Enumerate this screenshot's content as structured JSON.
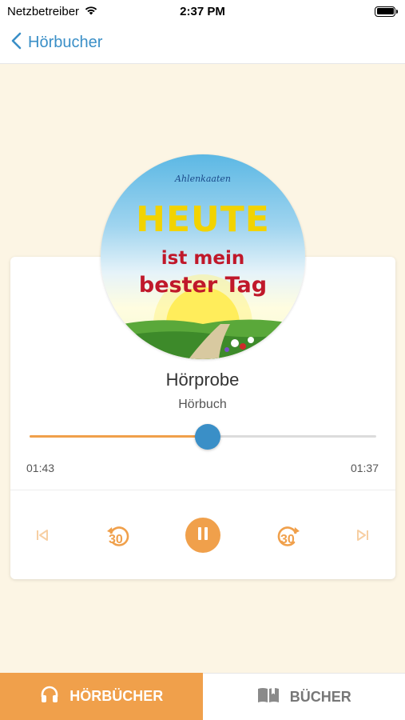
{
  "status_bar": {
    "carrier": "Netzbetreiber",
    "time": "2:37 PM",
    "wifi_icon": "wifi-icon",
    "battery_icon": "battery-icon"
  },
  "nav": {
    "back_label": "Hörbucher",
    "back_icon": "chevron-left-icon"
  },
  "cover": {
    "brand": "Ahlenkaaten",
    "title_line1": "HEUTE",
    "title_line2": "ist mein",
    "title_line3": "bester Tag"
  },
  "player": {
    "title": "Hörprobe",
    "subtitle": "Hörbuch",
    "elapsed": "01:43",
    "remaining": "01:37",
    "progress": 0.513,
    "controls": [
      "skip-previous-icon",
      "rewind-30-icon",
      "pause-icon",
      "forward-30-icon",
      "skip-next-icon"
    ],
    "rewind_label": "30",
    "forward_label": "30"
  },
  "tabs": [
    {
      "label": "HÖRBÜCHER",
      "icon": "headphones-icon",
      "active": true
    },
    {
      "label": "BÜCHER",
      "icon": "book-icon",
      "active": false
    }
  ],
  "colors": {
    "accent_orange": "#f0a04b",
    "accent_blue": "#3a8fc7",
    "background": "#fcf5e4"
  }
}
